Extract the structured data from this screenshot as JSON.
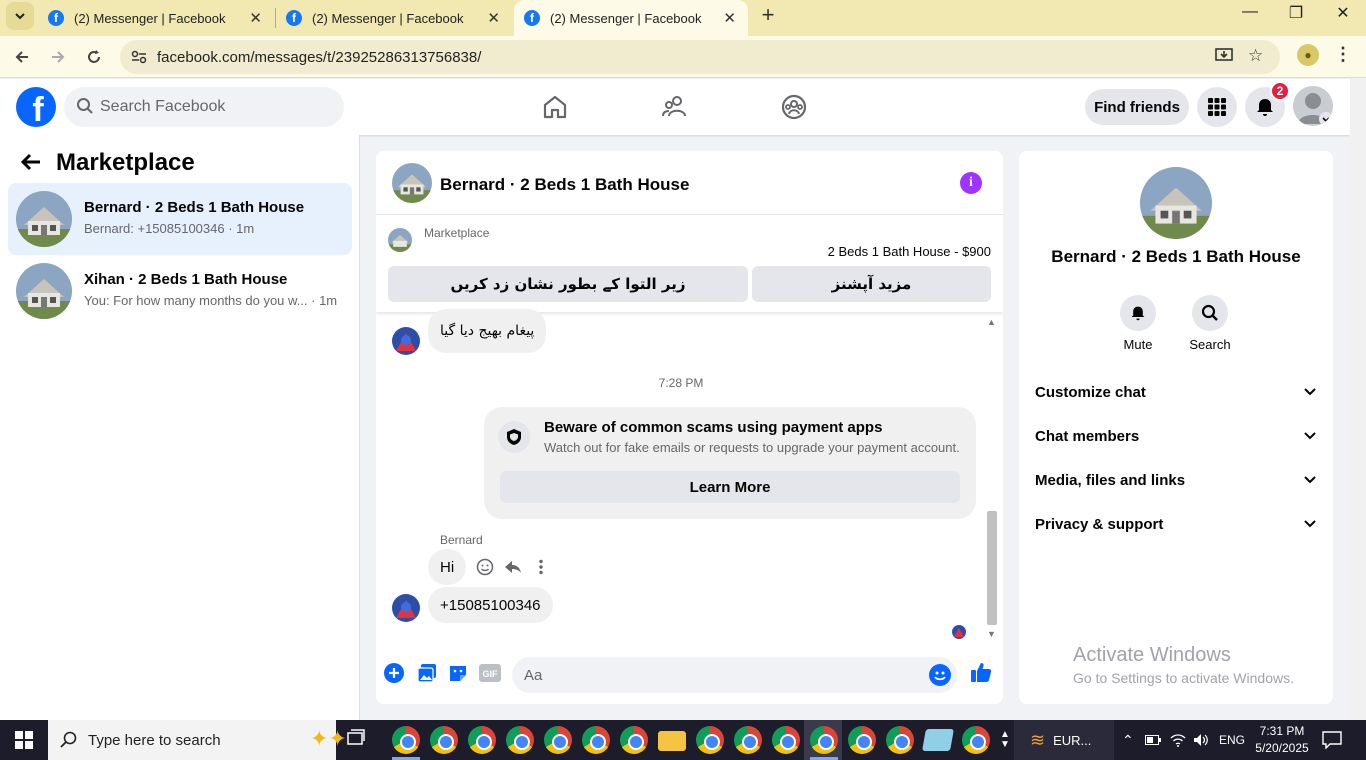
{
  "browser": {
    "tabs": [
      {
        "title": "(2) Messenger | Facebook"
      },
      {
        "title": "(2) Messenger | Facebook"
      },
      {
        "title": "(2) Messenger | Facebook"
      }
    ],
    "url": "facebook.com/messages/t/23925286313756838/"
  },
  "header": {
    "search_placeholder": "Search Facebook",
    "find_friends": "Find friends",
    "notification_count": "2"
  },
  "left": {
    "title": "Marketplace",
    "conversations": [
      {
        "title": "Bernard · 2 Beds 1 Bath House",
        "subtitle": "Bernard: +15085100346 · 1m"
      },
      {
        "title": "Xihan · 2 Beds 1 Bath House",
        "subtitle": "You: For how many months do you w... · 1m"
      }
    ]
  },
  "chat": {
    "title": "Bernard · 2 Beds 1 Bath House",
    "marketplace_label": "Marketplace",
    "listing": "2 Beds 1 Bath House - $900",
    "btn_more_options": "مزید آپشنز",
    "btn_mark_pending": "زیر التوا کے بطور نشان زد کریں",
    "message_sent": "پیغام بھیج دیا گیا",
    "timestamp": "7:28 PM",
    "scam_title": "Beware of common scams using payment apps",
    "scam_desc": "Watch out for fake emails or requests to upgrade your payment account.",
    "learn_more": "Learn More",
    "sender_name": "Bernard",
    "msg_hi": "Hi",
    "msg_phone": "+15085100346",
    "composer_placeholder": "Aa"
  },
  "right": {
    "name": "Bernard · 2 Beds 1 Bath House",
    "mute": "Mute",
    "search": "Search",
    "rows": [
      "Customize chat",
      "Chat members",
      "Media, files and links",
      "Privacy & support"
    ]
  },
  "watermark": {
    "line1": "Activate Windows",
    "line2": "Go to Settings to activate Windows."
  },
  "taskbar": {
    "search_placeholder": "Type here to search",
    "weather": "EUR...",
    "lang": "ENG",
    "time": "7:31 PM",
    "date": "5/20/2025"
  },
  "colors": {
    "fb_blue": "#0866ff",
    "messenger_accent": "#a033ff",
    "tabstrip": "#f1e8b2",
    "toolbar": "#fdfae8"
  }
}
